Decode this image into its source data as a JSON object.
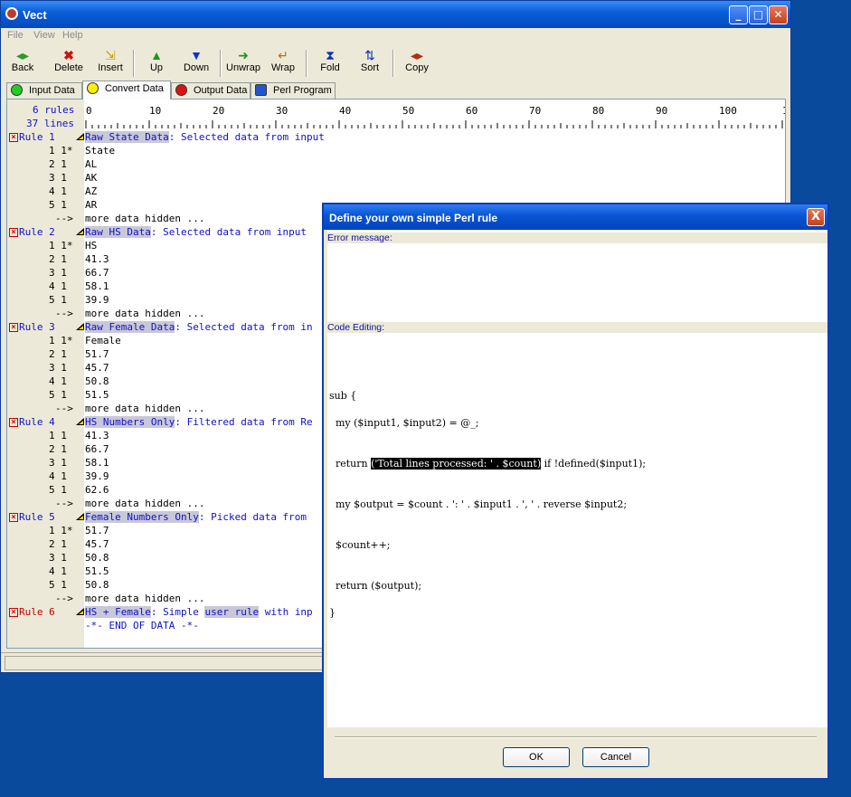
{
  "window": {
    "title": "Vect"
  },
  "menu": [
    "File",
    "View",
    "Help"
  ],
  "toolbar": [
    {
      "label": "Back",
      "icon": "back-arrows-icon"
    },
    {
      "label": "Delete",
      "icon": "delete-x-icon"
    },
    {
      "label": "Insert",
      "icon": "insert-icon"
    },
    {
      "label": "Up",
      "icon": "up-arrow-icon"
    },
    {
      "label": "Down",
      "icon": "down-arrow-icon"
    },
    {
      "label": "Unwrap",
      "icon": "unwrap-arrow-icon"
    },
    {
      "label": "Wrap",
      "icon": "wrap-arrow-icon"
    },
    {
      "label": "Fold",
      "icon": "fold-icon"
    },
    {
      "label": "Sort",
      "icon": "sort-icon"
    },
    {
      "label": "Copy",
      "icon": "copy-arrows-icon"
    }
  ],
  "tabs": [
    {
      "label": "Input Data",
      "color": "#22cc22"
    },
    {
      "label": "Convert Data",
      "color": "#ffee00"
    },
    {
      "label": "Output Data",
      "color": "#dd1111"
    },
    {
      "label": "Perl Program",
      "color": "#2255cc"
    }
  ],
  "panel": {
    "rules_count": "6 rules",
    "lines_count": "37 lines",
    "ruler_ticks": [
      "0",
      "10",
      "20",
      "30",
      "40",
      "50",
      "60",
      "70",
      "80",
      "90",
      "100",
      "1"
    ],
    "rows": [
      {
        "gutter": "Rule 1",
        "kind": "rule",
        "title": "Raw State Data",
        "rest": ": Selected data from input"
      },
      {
        "gutter": "1 1*",
        "kind": "data",
        "text": "State"
      },
      {
        "gutter": "2 1",
        "kind": "data",
        "text": "AL"
      },
      {
        "gutter": "3 1",
        "kind": "data",
        "text": "AK"
      },
      {
        "gutter": "4 1",
        "kind": "data",
        "text": "AZ"
      },
      {
        "gutter": "5 1",
        "kind": "data",
        "text": "AR"
      },
      {
        "gutter": "-->",
        "kind": "more",
        "text": "more data hidden ..."
      },
      {
        "gutter": "Rule 2",
        "kind": "rule",
        "title": "Raw HS Data",
        "rest": ": Selected data from input"
      },
      {
        "gutter": "1 1*",
        "kind": "data",
        "text": "HS"
      },
      {
        "gutter": "2 1",
        "kind": "data",
        "text": "41.3"
      },
      {
        "gutter": "3 1",
        "kind": "data",
        "text": "66.7"
      },
      {
        "gutter": "4 1",
        "kind": "data",
        "text": "58.1"
      },
      {
        "gutter": "5 1",
        "kind": "data",
        "text": "39.9"
      },
      {
        "gutter": "-->",
        "kind": "more",
        "text": "more data hidden ..."
      },
      {
        "gutter": "Rule 3",
        "kind": "rule",
        "title": "Raw Female Data",
        "rest": ": Selected data from in"
      },
      {
        "gutter": "1 1*",
        "kind": "data",
        "text": "Female"
      },
      {
        "gutter": "2 1",
        "kind": "data",
        "text": "51.7"
      },
      {
        "gutter": "3 1",
        "kind": "data",
        "text": "45.7"
      },
      {
        "gutter": "4 1",
        "kind": "data",
        "text": "50.8"
      },
      {
        "gutter": "5 1",
        "kind": "data",
        "text": "51.5"
      },
      {
        "gutter": "-->",
        "kind": "more",
        "text": "more data hidden ..."
      },
      {
        "gutter": "Rule 4",
        "kind": "rule",
        "title": "HS Numbers Only",
        "rest": ": Filtered data from Re"
      },
      {
        "gutter": "1 1",
        "kind": "data",
        "text": "41.3"
      },
      {
        "gutter": "2 1",
        "kind": "data",
        "text": "66.7"
      },
      {
        "gutter": "3 1",
        "kind": "data",
        "text": "58.1"
      },
      {
        "gutter": "4 1",
        "kind": "data",
        "text": "39.9"
      },
      {
        "gutter": "5 1",
        "kind": "data",
        "text": "62.6"
      },
      {
        "gutter": "-->",
        "kind": "more",
        "text": "more data hidden ..."
      },
      {
        "gutter": "Rule 5",
        "kind": "rule",
        "title": "Female Numbers Only",
        "rest": ": Picked data from"
      },
      {
        "gutter": "1 1*",
        "kind": "data",
        "text": "51.7"
      },
      {
        "gutter": "2 1",
        "kind": "data",
        "text": "45.7"
      },
      {
        "gutter": "3 1",
        "kind": "data",
        "text": "50.8"
      },
      {
        "gutter": "4 1",
        "kind": "data",
        "text": "51.5"
      },
      {
        "gutter": "5 1",
        "kind": "data",
        "text": "50.8"
      },
      {
        "gutter": "-->",
        "kind": "more",
        "text": "more data hidden ..."
      },
      {
        "gutter": "Rule 6",
        "kind": "rule6",
        "title": "HS + Female",
        "mid": ": Simple ",
        "hl2": "user rule",
        "rest": " with inp"
      },
      {
        "gutter": "",
        "kind": "end",
        "text": "-*- END OF DATA -*-"
      }
    ]
  },
  "dialog": {
    "title": "Define your own simple Perl rule",
    "close_label": "X",
    "error_label": "Error message:",
    "code_label": "Code Editing:",
    "code": [
      {
        "text": "sub {"
      },
      {
        "text": "  my ($input1, $input2) = @_;"
      },
      {
        "pre": "  return ",
        "sel": "('Total lines processed: ' . $count)",
        "post": " if !defined($input1);"
      },
      {
        "text": "  my $output = $count . ': ' . $input1 . ', ' . reverse $input2;"
      },
      {
        "text": "  $count++;"
      },
      {
        "text": "  return ($output);"
      },
      {
        "text": "}"
      }
    ],
    "ok_label": "OK",
    "cancel_label": "Cancel"
  }
}
